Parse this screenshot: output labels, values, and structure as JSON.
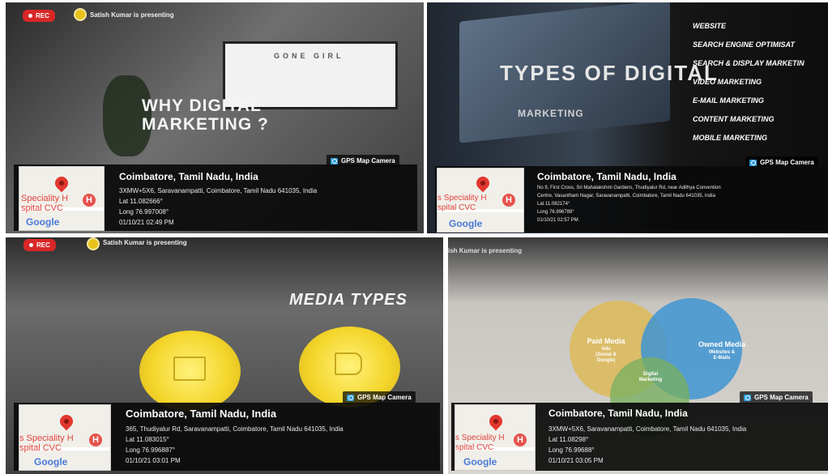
{
  "meeting": {
    "rec_label": "REC",
    "presenter_text": "Satish Kumar is presenting",
    "presenter_text_partial": "ish Kumar is presenting"
  },
  "panels": [
    {
      "slide_title": "WHY DIGITAL MARKETING ?",
      "tv_text": "GONE GIRL",
      "gps_badge": "GPS Map Camera",
      "location": {
        "title": "Coimbatore, Tamil Nadu, India",
        "address": "3XMW+5X6, Saravanampatti, Coimbatore, Tamil Nadu 641035, India",
        "lat": "Lat 11.082666°",
        "long": "Long 76.997008°",
        "datetime": "01/10/21 02:49 PM"
      },
      "map": {
        "hospital": "Speciality H\nspital CVC",
        "logo": "Google"
      }
    },
    {
      "slide_title": "TYPES OF DIGITAL",
      "slide_subtitle": "MARKETING",
      "menu_items": [
        "WEBSITE",
        "SEARCH ENGINE OPTIMISAT",
        "SEARCH & DISPLAY MARKETIN",
        "VIDEO MARKETING",
        "E-MAIL MARKETING",
        "CONTENT MARKETING",
        "MOBILE MARKETING"
      ],
      "gps_badge": "GPS Map Camera",
      "location": {
        "title": "Coimbatore, Tamil Nadu, India",
        "address_1": "No 9, First Cross, Sri Mahalakshmi Gardens, Thudiyalur Rd, near Adithya Convention",
        "address_2": "Centre, Vasantham Nagar, Saravanampatti, Coimbatore, Tamil Nadu 641035, India",
        "lat": "Lat 11.082174°",
        "long": "Long 76.996789°",
        "datetime": "01/10/21 02:57 PM"
      },
      "map": {
        "hospital": "s Speciality H\nspital CVC",
        "logo": "Google"
      }
    },
    {
      "slide_title": "MEDIA TYPES",
      "gps_badge": "GPS Map Camera",
      "location": {
        "title": "Coimbatore, Tamil Nadu, India",
        "address": "365, Thudiyalur Rd, Saravanampatti, Coimbatore, Tamil Nadu 641035, India",
        "lat": "Lat 11.083015°",
        "long": "Long 76.996887°",
        "datetime": "01/10/21 03:01 PM"
      },
      "map": {
        "hospital": "s Speciality H\nspital CVC",
        "logo": "Google"
      }
    },
    {
      "venn": {
        "paid": "Paid Media",
        "paid_sub": "Ads\n(Social &\nGoogle)",
        "owned": "Owned Media",
        "owned_sub": "Websites &\nE-Mails",
        "digital": "Digital\nMarketing"
      },
      "gps_badge": "GPS Map Camera",
      "location": {
        "title": "Coimbatore, Tamil Nadu, India",
        "address": "3XMW+5X6, Saravanampatti, Coimbatore, Tamil Nadu 641035, India",
        "lat": "Lat 11.08298°",
        "long": "Long 76.99688°",
        "datetime": "01/10/21 03:05 PM"
      },
      "map": {
        "hospital": "s Speciality H\nspital CVC",
        "logo": "Google"
      }
    }
  ]
}
